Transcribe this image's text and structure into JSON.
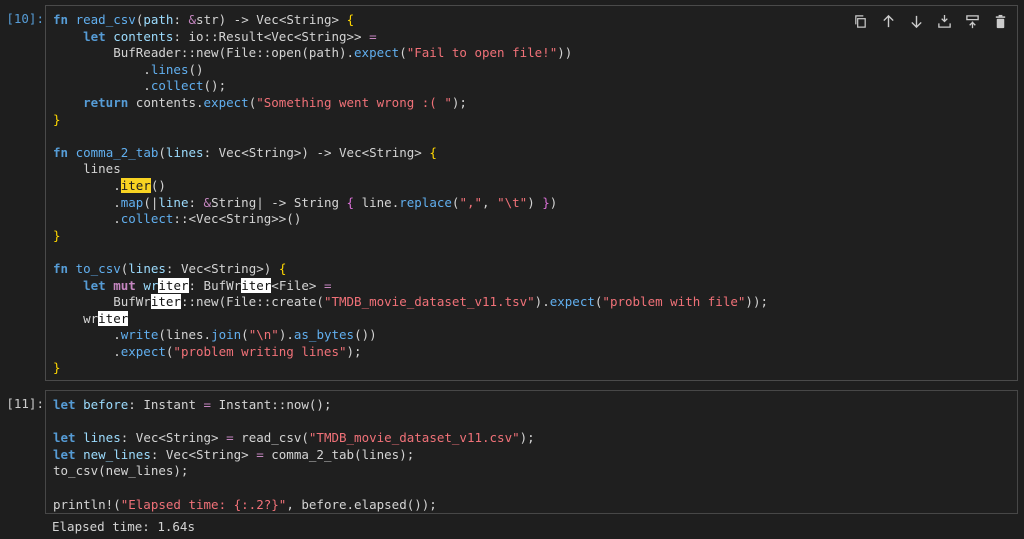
{
  "cells": [
    {
      "prompt": "[10]:",
      "lines": [
        "fn read_csv(path: &str) -> Vec<String> {",
        "    let contents: io::Result<Vec<String>> =",
        "        BufReader::new(File::open(path).expect(\"Fail to open file!\"))",
        "            .lines()",
        "            .collect();",
        "    return contents.expect(\"Something went wrong :( \");",
        "}",
        "",
        "fn comma_2_tab(lines: Vec<String>) -> Vec<String> {",
        "    lines",
        "        .iter()",
        "        .map(|line: &String| -> String { line.replace(\",\", \"\\t\") })",
        "        .collect::<Vec<String>>()",
        "}",
        "",
        "fn to_csv(lines: Vec<String>) {",
        "    let mut writer: BufWriter<File> =",
        "        BufWriter::new(File::create(\"TMDB_movie_dataset_v11.tsv\").expect(\"problem with file\"));",
        "    writer",
        "        .write(lines.join(\"\\n\").as_bytes())",
        "        .expect(\"problem writing lines\");",
        "}"
      ]
    },
    {
      "prompt": "[11]:",
      "lines": [
        "let before: Instant = Instant::now();",
        "",
        "let lines: Vec<String> = read_csv(\"TMDB_movie_dataset_v11.csv\");",
        "let new_lines: Vec<String> = comma_2_tab(lines);",
        "to_csv(new_lines);",
        "",
        "println!(\"Elapsed time: {:.2?}\", before.elapsed());"
      ],
      "output": "Elapsed time: 1.64s"
    }
  ],
  "toolbar": {
    "buttons": [
      "copy-icon",
      "move-up-icon",
      "move-down-icon",
      "insert-above-icon",
      "insert-below-icon",
      "delete-icon"
    ]
  }
}
